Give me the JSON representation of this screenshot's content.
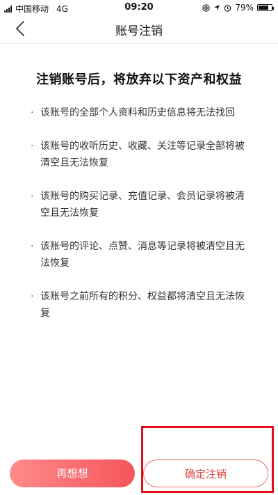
{
  "status_bar": {
    "carrier": "中国移动",
    "network": "4G",
    "time": "09:20",
    "battery_percent": "79%",
    "battery_level": 0.79
  },
  "nav": {
    "title": "账号注销"
  },
  "content": {
    "title": "注销账号后，将放弃以下资产和权益",
    "bullet": "·",
    "items": [
      "该账号的全部个人资料和历史信息将无法找回",
      "该账号的收听历史、收藏、关注等记录全部将被清空且无法恢复",
      "该账号的购买记录、充值记录、会员记录将被清空且无法恢复",
      "该账号的评论、点赞、消息等记录将被清空且无法恢复",
      "该账号之前所有的积分、权益都将清空且无法恢复"
    ]
  },
  "buttons": {
    "rethink_label": "再想想",
    "confirm_label": "确定注销"
  },
  "colors": {
    "accent": "#f4555c",
    "highlight": "#e3101b"
  }
}
